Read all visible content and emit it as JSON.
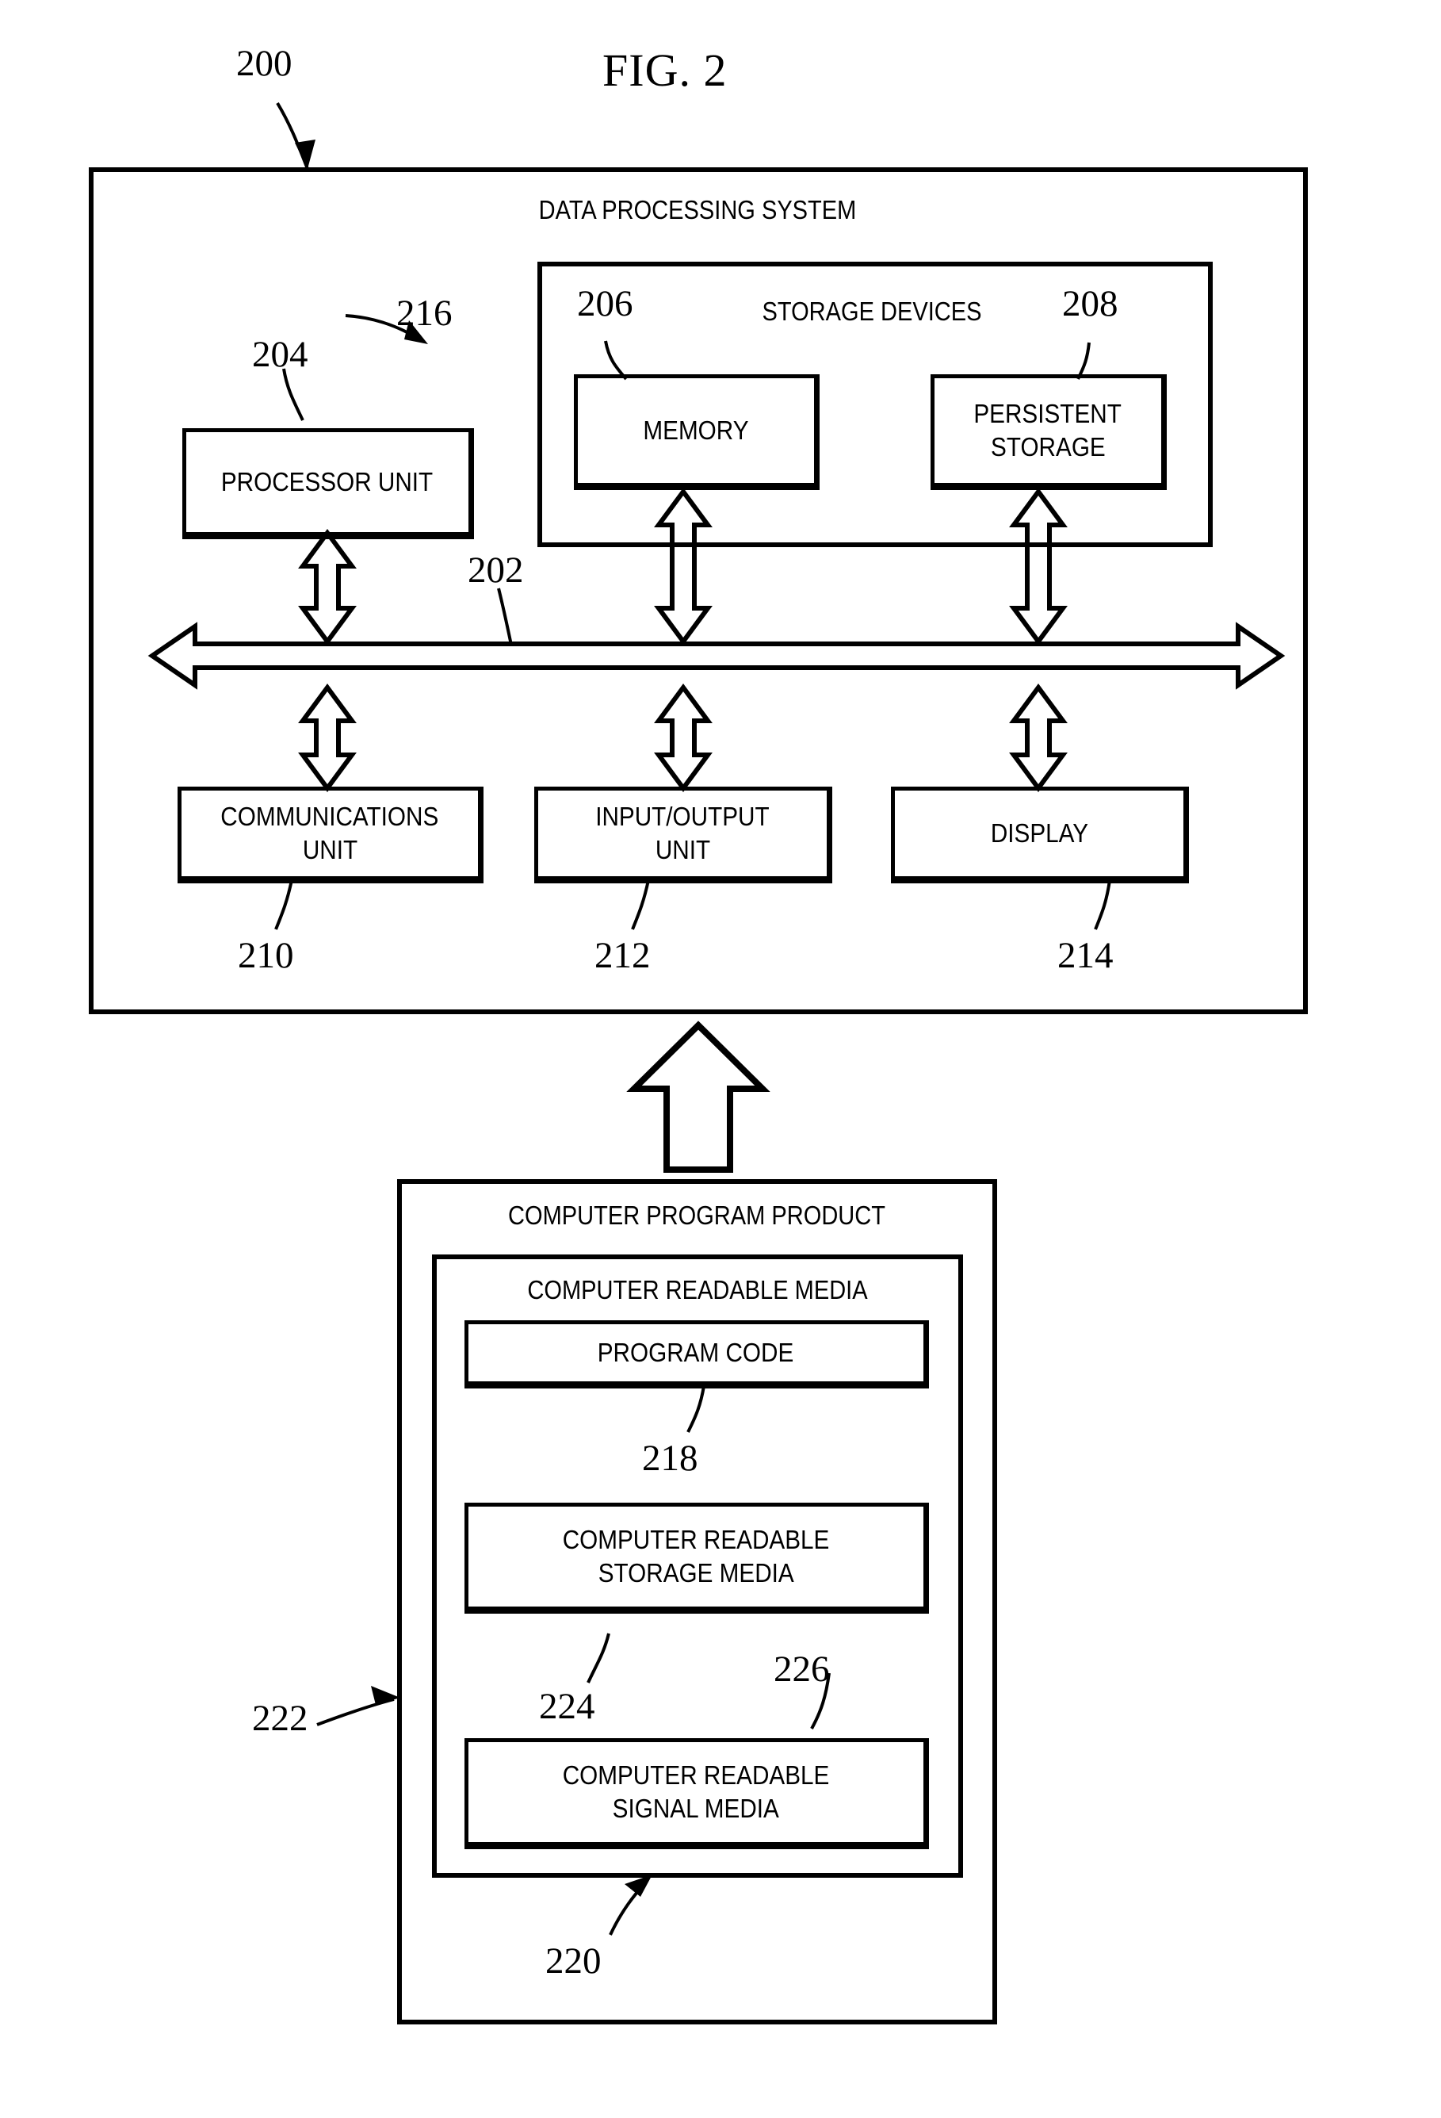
{
  "figure": {
    "title": "FIG. 2",
    "system_ref": "200"
  },
  "system": {
    "title": "DATA PROCESSING SYSTEM",
    "bus_ref": "202",
    "processor": {
      "label": "PROCESSOR UNIT",
      "ref": "204"
    },
    "storage_devices": {
      "title": "STORAGE DEVICES",
      "ref": "216",
      "items": [
        {
          "label": "MEMORY",
          "ref": "206"
        },
        {
          "label_line1": "PERSISTENT",
          "label_line2": "STORAGE",
          "ref": "208"
        }
      ]
    },
    "io_row": [
      {
        "label_line1": "COMMUNICATIONS",
        "label_line2": "UNIT",
        "ref": "210"
      },
      {
        "label_line1": "INPUT/OUTPUT",
        "label_line2": "UNIT",
        "ref": "212"
      },
      {
        "label_line1": "DISPLAY",
        "label_line2": "",
        "ref": "214"
      }
    ]
  },
  "program_product": {
    "title": "COMPUTER PROGRAM PRODUCT",
    "ref": "222",
    "media": {
      "title": "COMPUTER READABLE MEDIA",
      "ref": "220",
      "items": [
        {
          "label_line1": "PROGRAM CODE",
          "label_line2": "",
          "ref": "218"
        },
        {
          "label_line1": "COMPUTER READABLE",
          "label_line2": "STORAGE MEDIA",
          "ref": "224"
        },
        {
          "label_line1": "COMPUTER READABLE",
          "label_line2": "SIGNAL MEDIA",
          "ref": "226"
        }
      ]
    }
  },
  "colors": {
    "ink": "#000000",
    "paper": "#ffffff"
  }
}
